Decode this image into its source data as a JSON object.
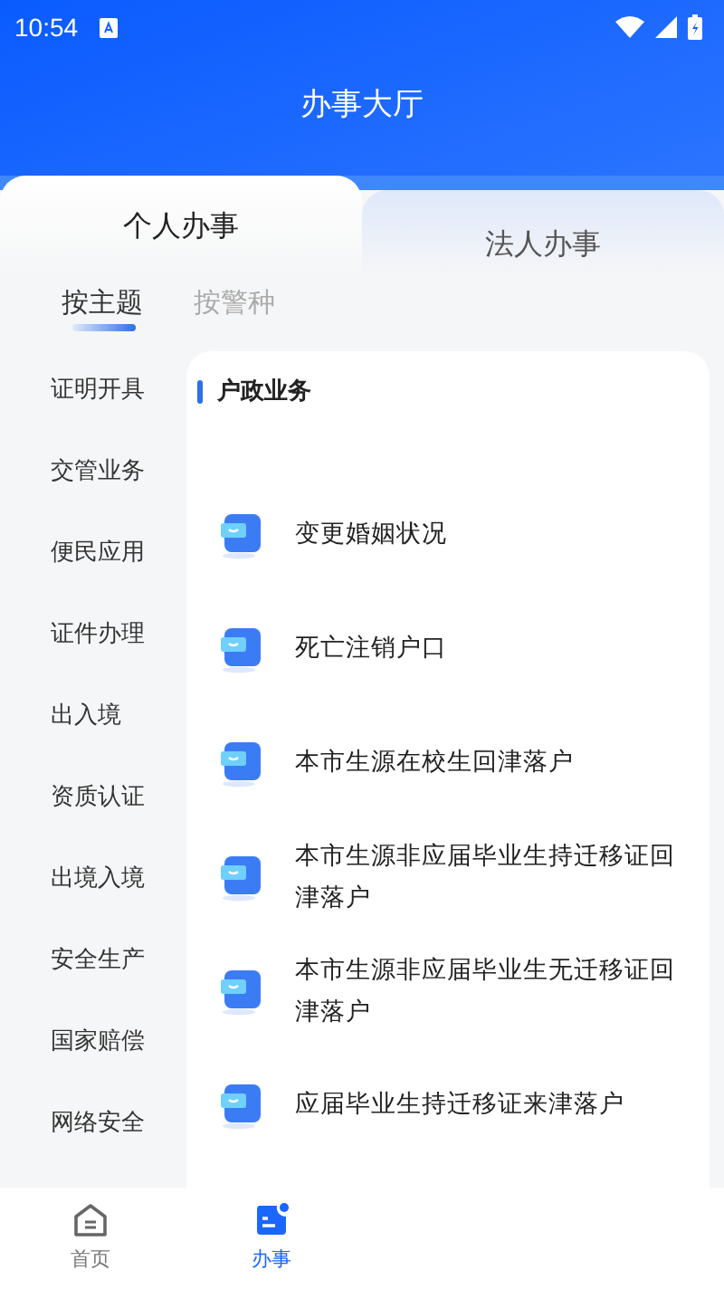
{
  "status_bar": {
    "time": "10:54"
  },
  "header": {
    "title": "办事大厅"
  },
  "tabs": [
    {
      "label": "个人办事",
      "selected": true
    },
    {
      "label": "法人办事",
      "selected": false
    }
  ],
  "sub_tabs": [
    {
      "label": "按主题",
      "selected": true
    },
    {
      "label": "按警种",
      "selected": false
    }
  ],
  "sidebar": {
    "items": [
      "证明开具",
      "交管业务",
      "便民应用",
      "证件办理",
      "出入境",
      "资质认证",
      "出境入境",
      "安全生产",
      "国家赔偿",
      "网络安全"
    ]
  },
  "section": {
    "title": "户政业务",
    "items": [
      "变更婚姻状况",
      "死亡注销户口",
      "本市生源在校生回津落户",
      "本市生源非应届毕业生持迁移证回津落户",
      "本市生源非应届毕业生无迁移证回津落户",
      "应届毕业生持迁移证来津落户"
    ]
  },
  "bottom_nav": [
    {
      "label": "首页",
      "kind": "home",
      "selected": false
    },
    {
      "label": "办事",
      "kind": "service",
      "selected": true
    }
  ]
}
